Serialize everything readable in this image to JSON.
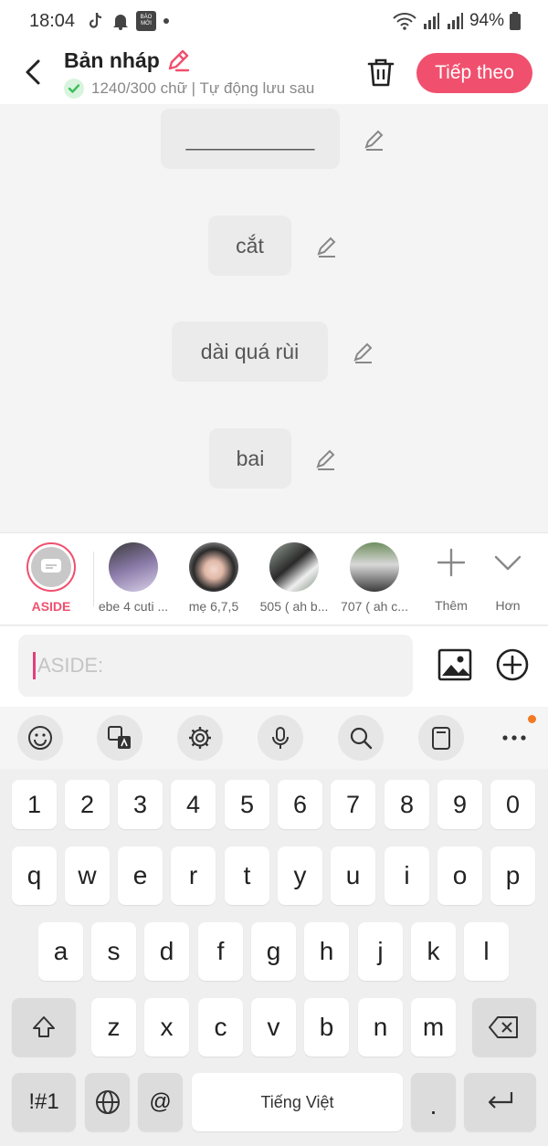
{
  "status_bar": {
    "time": "18:04",
    "battery": "94%",
    "news_badge": "BÁO MỚI"
  },
  "header": {
    "title": "Bản nháp",
    "subtitle": "1240/300 chữ | Tự động lưu sau",
    "next_label": "Tiếp theo"
  },
  "messages": [
    {
      "text": "___________"
    },
    {
      "text": "cắt"
    },
    {
      "text": "dài quá rùi"
    },
    {
      "text": "bai"
    }
  ],
  "characters": {
    "aside_label": "ASIDE",
    "items": [
      {
        "name": "ebe 4 cuti ..."
      },
      {
        "name": "mẹ 6,7,5"
      },
      {
        "name": "505 ( ah b..."
      },
      {
        "name": "707 ( ah c..."
      }
    ],
    "more_label": "Thêm",
    "expand_label": "Hơn"
  },
  "composer": {
    "placeholder": "ASIDE:"
  },
  "keyboard": {
    "row_numbers": [
      "1",
      "2",
      "3",
      "4",
      "5",
      "6",
      "7",
      "8",
      "9",
      "0"
    ],
    "row_1": [
      "q",
      "w",
      "e",
      "r",
      "t",
      "y",
      "u",
      "i",
      "o",
      "p"
    ],
    "row_2": [
      "a",
      "s",
      "d",
      "f",
      "g",
      "h",
      "j",
      "k",
      "l"
    ],
    "row_3": [
      "z",
      "x",
      "c",
      "v",
      "b",
      "n",
      "m"
    ],
    "symbols_label": "!#1",
    "at_label": "@",
    "space_label": "Tiếng Việt",
    "period_label": "."
  },
  "colors": {
    "accent": "#f0506e",
    "check_green": "#3cbf5a"
  }
}
